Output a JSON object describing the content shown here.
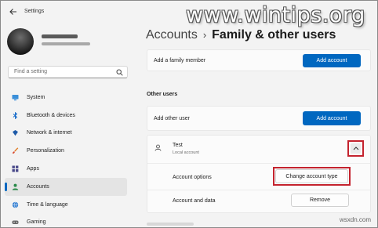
{
  "window": {
    "title": "Settings"
  },
  "search": {
    "placeholder": "Find a setting"
  },
  "sidebar": {
    "items": [
      {
        "label": "System",
        "icon": "monitor-icon"
      },
      {
        "label": "Bluetooth & devices",
        "icon": "bluetooth-icon"
      },
      {
        "label": "Network & internet",
        "icon": "wifi-icon"
      },
      {
        "label": "Personalization",
        "icon": "brush-icon"
      },
      {
        "label": "Apps",
        "icon": "apps-icon"
      },
      {
        "label": "Accounts",
        "icon": "person-icon",
        "active": true
      },
      {
        "label": "Time & language",
        "icon": "globe-icon"
      },
      {
        "label": "Gaming",
        "icon": "gamepad-icon"
      }
    ]
  },
  "breadcrumb": {
    "parent": "Accounts",
    "separator": "›",
    "current": "Family & other users"
  },
  "family": {
    "label": "Add a family member",
    "button": "Add account"
  },
  "other_users": {
    "title": "Other users",
    "add_label": "Add other user",
    "add_button": "Add account",
    "user": {
      "name": "Test",
      "type": "Local account"
    },
    "account_options_label": "Account options",
    "account_options_button": "Change account type",
    "account_data_label": "Account and data",
    "remove_button": "Remove"
  },
  "watermark": {
    "site": "www.wintips.org",
    "corner": "wsxdn.com"
  },
  "colors": {
    "accent": "#0067c0",
    "highlight": "#c4232e"
  }
}
